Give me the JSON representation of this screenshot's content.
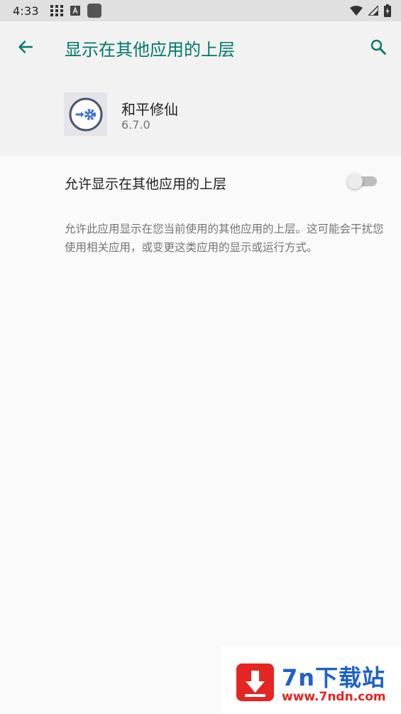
{
  "status_bar": {
    "time": "4:33",
    "icons": [
      "grid-icon",
      "a-badge-icon",
      "square-icon",
      "wifi-icon",
      "signal-icon",
      "battery-charging-icon"
    ]
  },
  "app_bar": {
    "title": "显示在其他应用的上层",
    "back_icon": "arrow-back-icon",
    "search_icon": "search-icon"
  },
  "app_info": {
    "name": "和平修仙",
    "version": "6.7.0",
    "icon": "redirect-settings-icon"
  },
  "setting": {
    "label": "允许显示在其他应用的上层",
    "enabled": false,
    "description": "允许此应用显示在您当前使用的其他应用的上层。这可能会干扰您使用相关应用，或变更这类应用的显示或运行方式。"
  },
  "watermark": {
    "title": "7n下载站",
    "url": "www.7ndn.com"
  },
  "colors": {
    "accent": "#00796b",
    "status_bar": "#e0e0e0",
    "header_bg": "#f2f2f2",
    "background": "#fafafa",
    "secondary_text": "#757575",
    "watermark_red": "#e52521",
    "watermark_blue": "#1f62c7"
  }
}
